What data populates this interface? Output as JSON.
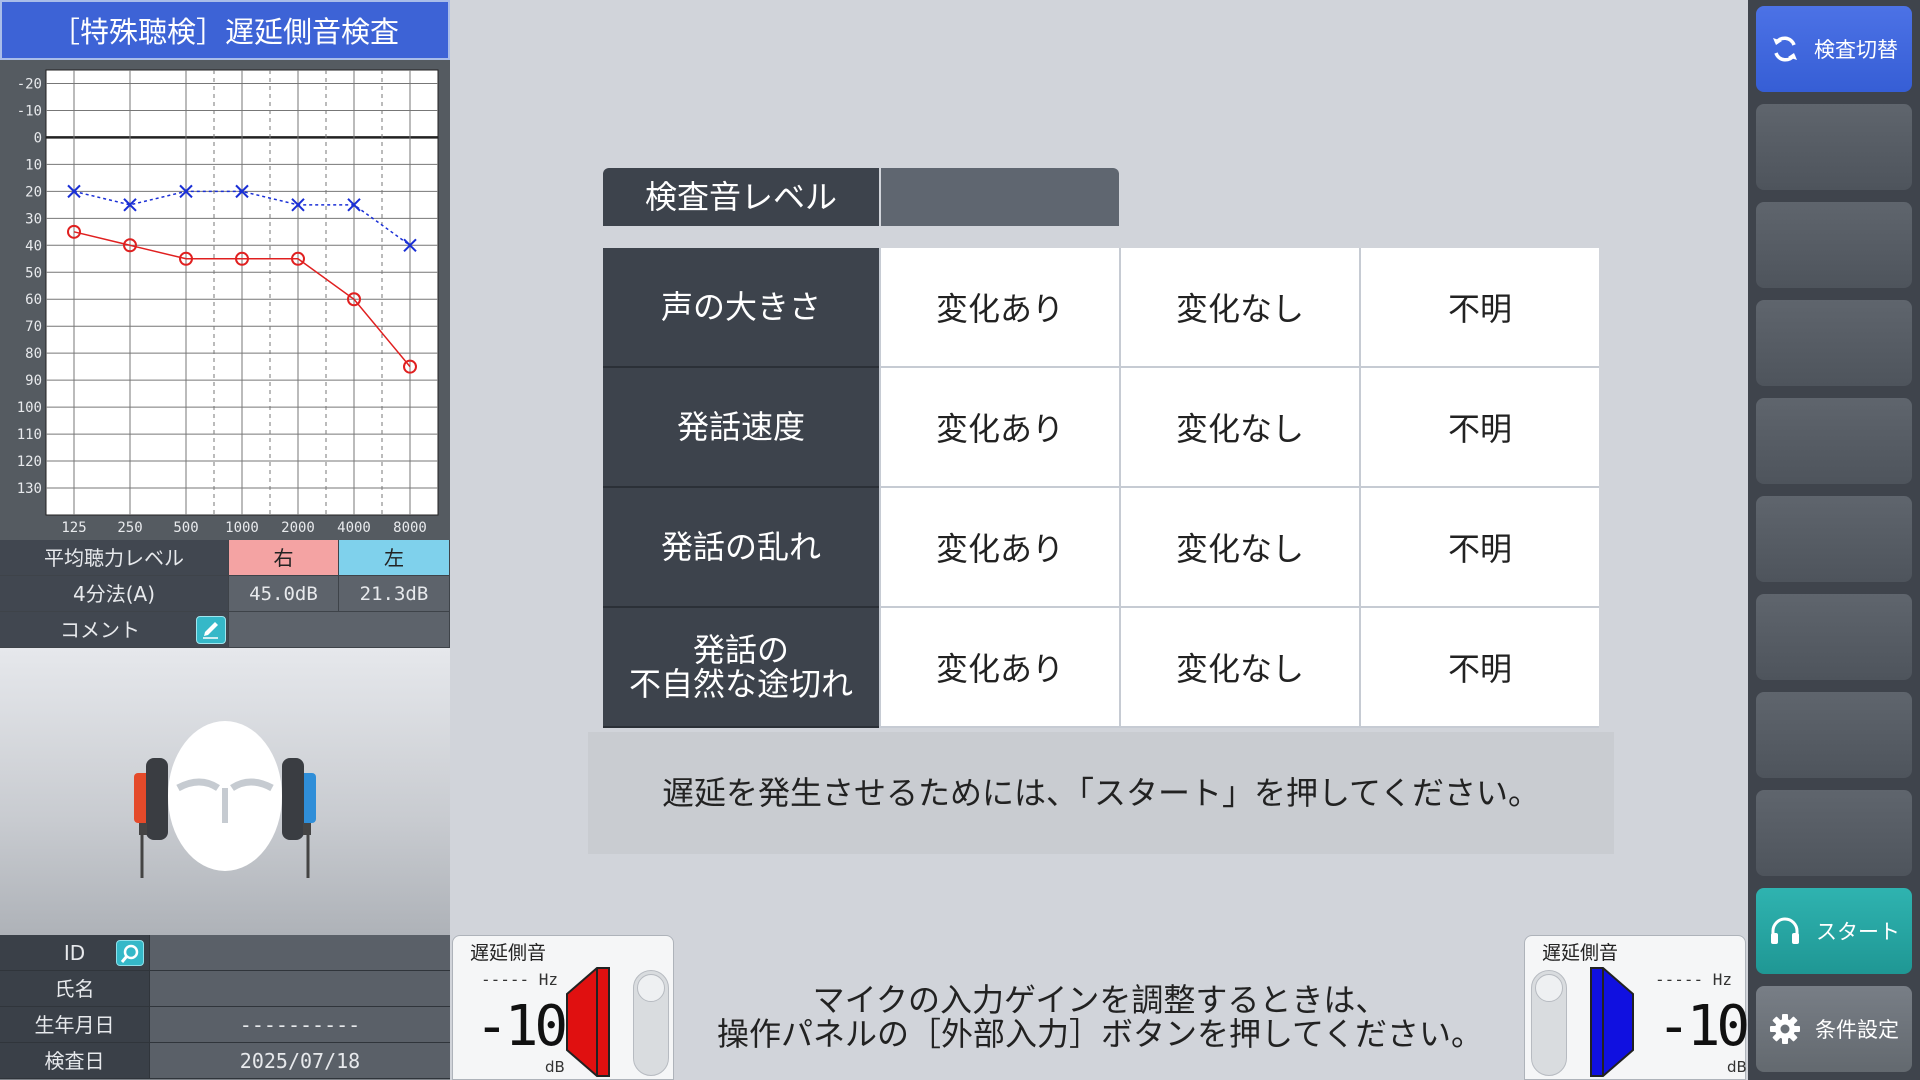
{
  "title": "［特殊聴検］遅延側音検査",
  "audiogram": {
    "y_ticks": [
      "-20",
      "-10",
      "0",
      "10",
      "20",
      "30",
      "40",
      "50",
      "60",
      "70",
      "80",
      "90",
      "100",
      "110",
      "120",
      "130"
    ],
    "x_ticks": [
      "125",
      "250",
      "500",
      "1000",
      "2000",
      "4000",
      "8000"
    ],
    "right_air": [
      35,
      40,
      45,
      45,
      45,
      60,
      85
    ],
    "left_air": [
      20,
      25,
      20,
      20,
      25,
      25,
      40
    ],
    "right_color": "#e02020",
    "left_color": "#1a2fd6"
  },
  "average": {
    "header_label": "平均聴力レベル",
    "right_label": "右",
    "left_label": "左",
    "method_label": "4分法(A)",
    "right_value": "45.0dB",
    "left_value": "21.3dB",
    "comment_label": "コメント",
    "right_color": "#f4a3a3",
    "left_color": "#7fd1ec"
  },
  "patient": {
    "id_label": "ID",
    "id_value": "",
    "name_label": "氏名",
    "name_value": "",
    "birth_label": "生年月日",
    "birth_value": "----------",
    "exam_label": "検査日",
    "exam_value": "2025/07/18"
  },
  "level": {
    "label": "検査音レベル",
    "value": ""
  },
  "results": [
    {
      "label": "声の大きさ",
      "options": [
        "変化あり",
        "変化なし",
        "不明"
      ]
    },
    {
      "label": "発話速度",
      "options": [
        "変化あり",
        "変化なし",
        "不明"
      ]
    },
    {
      "label": "発話の乱れ",
      "options": [
        "変化あり",
        "変化なし",
        "不明"
      ]
    },
    {
      "label": "発話の\n不自然な途切れ",
      "options": [
        "変化あり",
        "変化なし",
        "不明"
      ]
    }
  ],
  "message": "遅延を発生させるためには、「スタート」を押してください。",
  "bottom_message_line1": "マイクの入力ゲインを調整するときは、",
  "bottom_message_line2": "操作パネルの［外部入力］ボタンを押してください。",
  "output_left": {
    "title": "遅延側音",
    "hz": "----- Hz",
    "value": "-10",
    "unit": "dB",
    "color": "#e01010"
  },
  "output_right": {
    "title": "遅延側音",
    "hz": "----- Hz",
    "value": "-10",
    "unit": "dB",
    "color": "#1010e0"
  },
  "sidebar": {
    "switch_label": "検査切替",
    "start_label": "スタート",
    "settings_label": "条件設定"
  }
}
